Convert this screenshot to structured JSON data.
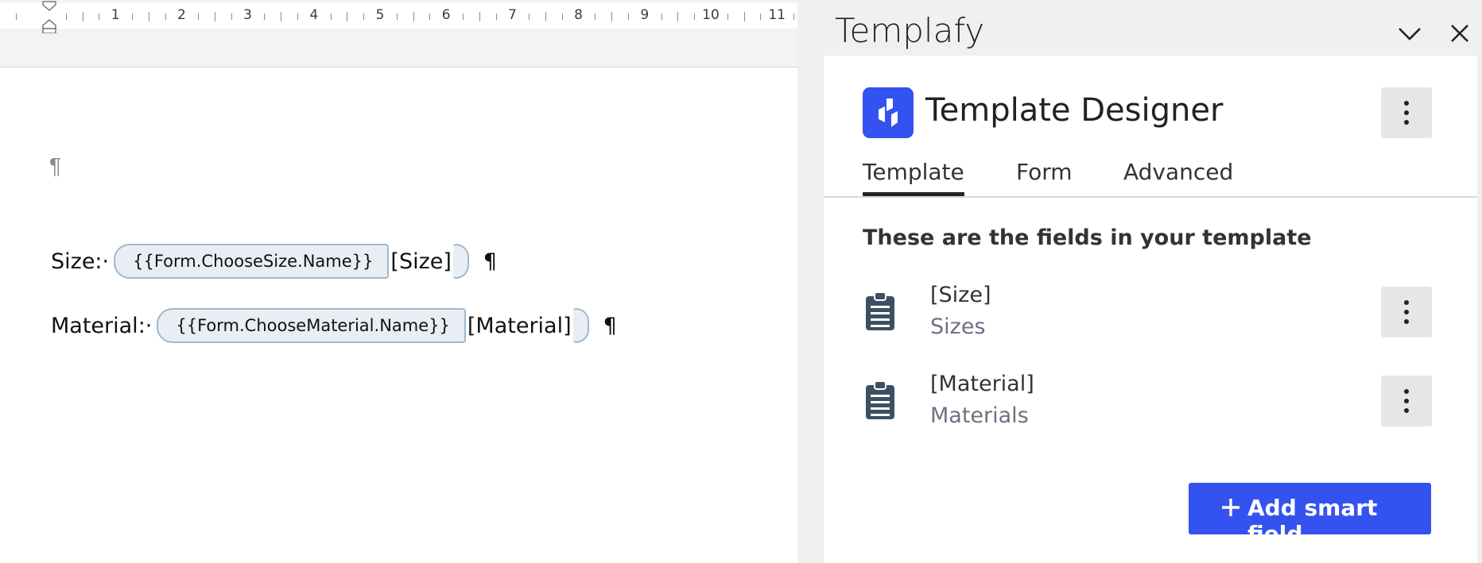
{
  "ruler": {
    "numbers": [
      "1",
      "2",
      "3",
      "4",
      "5",
      "6",
      "7",
      "8",
      "9",
      "10",
      "11"
    ]
  },
  "document": {
    "empty_paragraph_mark": "¶",
    "lines": [
      {
        "label": "Size:·",
        "tag": "{{Form.ChooseSize.Name}}",
        "value": "[Size]",
        "mark": "¶"
      },
      {
        "label": "Material:·",
        "tag": "{{Form.ChooseMaterial.Name}}",
        "value": "[Material]",
        "mark": "¶"
      }
    ]
  },
  "pane": {
    "title": "Templafy",
    "collapse_icon": "chevron-down-icon",
    "close_icon": "close-icon",
    "app_title": "Template Designer",
    "app_logo_icon": "templafy-logo-icon",
    "tabs": [
      {
        "label": "Template",
        "active": true
      },
      {
        "label": "Form",
        "active": false
      },
      {
        "label": "Advanced",
        "active": false
      }
    ],
    "fields_heading": "These are the fields in your template",
    "fields": [
      {
        "name": "[Size]",
        "source": "Sizes",
        "icon": "clipboard-icon"
      },
      {
        "name": "[Material]",
        "source": "Materials",
        "icon": "clipboard-icon"
      }
    ],
    "add_button_label": "Add smart field",
    "accent_color": "#3452f0"
  }
}
